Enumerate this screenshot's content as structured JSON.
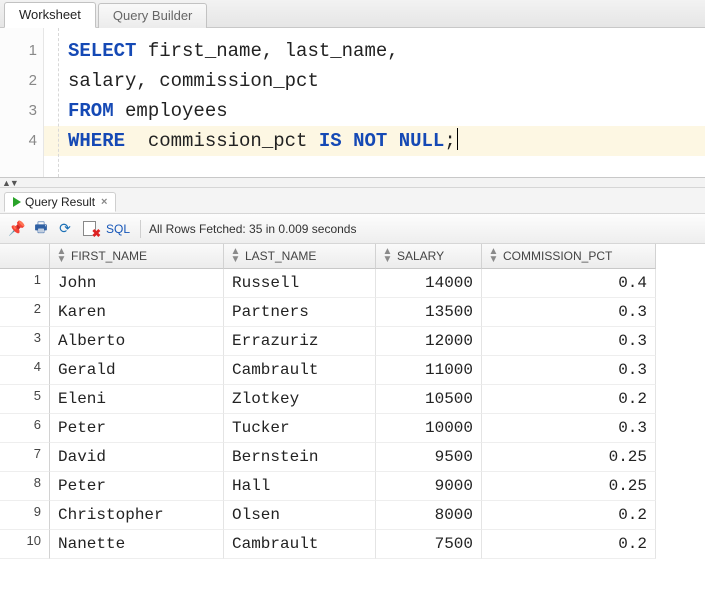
{
  "tabs": {
    "worksheet": "Worksheet",
    "query_builder": "Query Builder"
  },
  "sql": {
    "lines": [
      [
        {
          "t": "SELECT",
          "k": true
        },
        {
          "t": " first_name, last_name,",
          "k": false
        }
      ],
      [
        {
          "t": "salary, commission_pct",
          "k": false
        }
      ],
      [
        {
          "t": "FROM",
          "k": true
        },
        {
          "t": " employees",
          "k": false
        }
      ],
      [
        {
          "t": "WHERE",
          "k": true
        },
        {
          "t": "  commission_pct ",
          "k": false
        },
        {
          "t": "IS",
          "k": true
        },
        {
          "t": " ",
          "k": false
        },
        {
          "t": "NOT",
          "k": true
        },
        {
          "t": " ",
          "k": false
        },
        {
          "t": "NULL",
          "k": true
        },
        {
          "t": ";",
          "k": false
        }
      ]
    ],
    "highlight_line": 4
  },
  "result_tab": {
    "label": "Query Result"
  },
  "toolbar": {
    "sql_link": "SQL",
    "status": "All Rows Fetched: 35 in 0.009 seconds"
  },
  "columns": [
    "FIRST_NAME",
    "LAST_NAME",
    "SALARY",
    "COMMISSION_PCT"
  ],
  "numeric_cols": [
    false,
    false,
    true,
    true
  ],
  "rows": [
    [
      "John",
      "Russell",
      "14000",
      "0.4"
    ],
    [
      "Karen",
      "Partners",
      "13500",
      "0.3"
    ],
    [
      "Alberto",
      "Errazuriz",
      "12000",
      "0.3"
    ],
    [
      "Gerald",
      "Cambrault",
      "11000",
      "0.3"
    ],
    [
      "Eleni",
      "Zlotkey",
      "10500",
      "0.2"
    ],
    [
      "Peter",
      "Tucker",
      "10000",
      "0.3"
    ],
    [
      "David",
      "Bernstein",
      "9500",
      "0.25"
    ],
    [
      "Peter",
      "Hall",
      "9000",
      "0.25"
    ],
    [
      "Christopher",
      "Olsen",
      "8000",
      "0.2"
    ],
    [
      "Nanette",
      "Cambrault",
      "7500",
      "0.2"
    ]
  ]
}
